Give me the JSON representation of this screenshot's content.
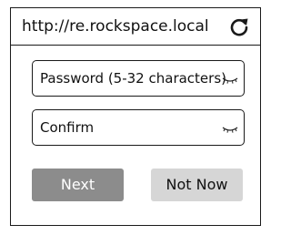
{
  "address_bar": {
    "url": "http://re.rockspace.local",
    "reload_icon": "reload-icon"
  },
  "form": {
    "password": {
      "placeholder": "Password (5-32 characters)",
      "toggle_icon": "eye-closed-icon"
    },
    "confirm": {
      "placeholder": "Confirm",
      "toggle_icon": "eye-closed-icon"
    }
  },
  "buttons": {
    "next": "Next",
    "not_now": "Not Now"
  },
  "colors": {
    "next_bg": "#8c8c8c",
    "not_now_bg": "#d6d6d6",
    "border": "#1a1a1a"
  }
}
